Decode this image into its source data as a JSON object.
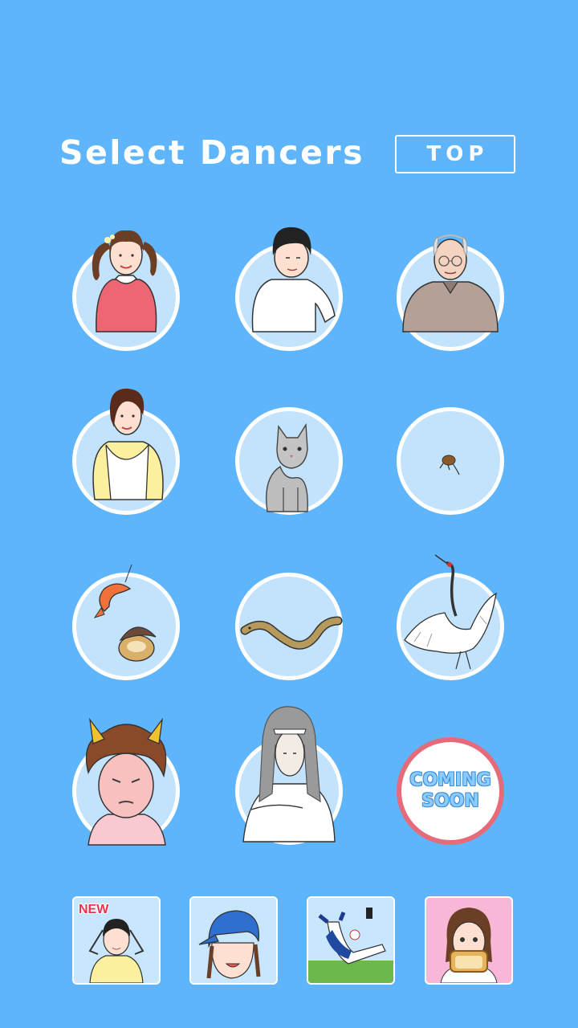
{
  "header": {
    "title": "Select Dancers",
    "top_button": "TOP"
  },
  "dancers": [
    {
      "id": "girl-pigtails",
      "label": ""
    },
    {
      "id": "boy",
      "label": ""
    },
    {
      "id": "grandpa",
      "label": ""
    },
    {
      "id": "mother",
      "label": ""
    },
    {
      "id": "cat",
      "label": ""
    },
    {
      "id": "flea",
      "label": ""
    },
    {
      "id": "shrimp-and-shell",
      "label": ""
    },
    {
      "id": "snake",
      "label": ""
    },
    {
      "id": "crane",
      "label": ""
    },
    {
      "id": "oni-demon",
      "label": ""
    },
    {
      "id": "ghost-woman",
      "label": ""
    },
    {
      "id": "coming-soon",
      "label_line1": "COMING",
      "label_line2": "SOON"
    }
  ],
  "apps": [
    {
      "id": "app-headache-boy",
      "badge": "NEW"
    },
    {
      "id": "app-cap-girl"
    },
    {
      "id": "app-baseball-pitcher"
    },
    {
      "id": "app-toast-girl"
    }
  ],
  "colors": {
    "background": "#5fb5fb",
    "ring_fill": "#c3e3fd",
    "coming_soon_border": "#e56b7b",
    "new_badge": "#e8334e"
  }
}
